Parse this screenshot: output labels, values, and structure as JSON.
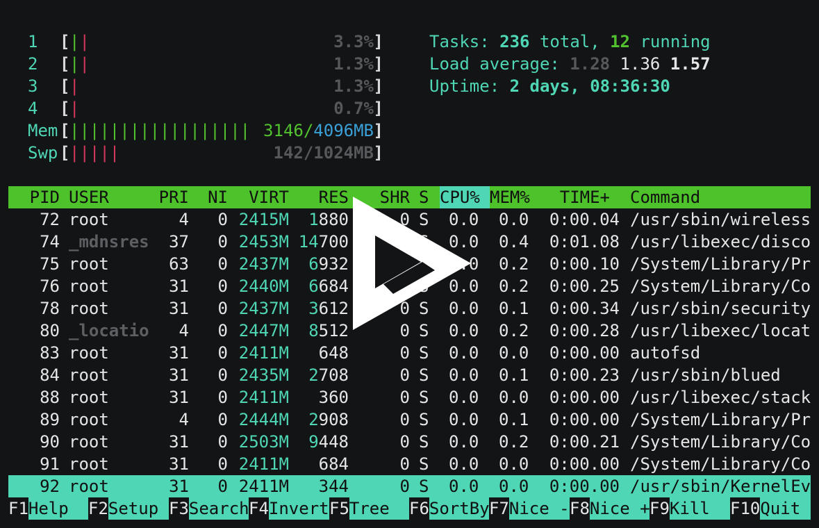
{
  "cpu_meters": [
    {
      "label": "1",
      "bars": [
        {
          "t": "|",
          "c": "green"
        },
        {
          "t": "|",
          "c": "red"
        }
      ],
      "value": "3.3%"
    },
    {
      "label": "2",
      "bars": [
        {
          "t": "|",
          "c": "green"
        },
        {
          "t": "|",
          "c": "red"
        }
      ],
      "value": "1.3%"
    },
    {
      "label": "3",
      "bars": [
        {
          "t": "|",
          "c": "red"
        }
      ],
      "value": "1.3%"
    },
    {
      "label": "4",
      "bars": [
        {
          "t": "|",
          "c": "red"
        }
      ],
      "value": "0.7%"
    }
  ],
  "mem": {
    "label": "Mem",
    "bars": "||||||||||||||||||",
    "used": "3146",
    "sep": "/",
    "total": "4096MB"
  },
  "swp": {
    "label": "Swp",
    "bars": "|||||",
    "value": "142/1024MB"
  },
  "tasks": {
    "prefix": "Tasks: ",
    "total": "236",
    "total_suffix": " total, ",
    "running": "12",
    "running_suffix": " running"
  },
  "load": {
    "prefix": "Load average: ",
    "l1": "1.28",
    "l5": "1.36",
    "l15": "1.57"
  },
  "uptime": {
    "prefix": "Uptime: ",
    "value": "2 days, 08:36:30"
  },
  "columns": {
    "pid": "PID",
    "user": "USER",
    "pri": "PRI",
    "ni": "NI",
    "virt": "VIRT",
    "res": "RES",
    "shr": "SHR",
    "s": "S",
    "cpu": "CPU%",
    "mem": "MEM%",
    "time": "TIME+",
    "command": "Command"
  },
  "processes": [
    {
      "pid": "72",
      "user": "root",
      "user_dim": false,
      "pri": "4",
      "ni": "0",
      "virt": "2415M",
      "res_hi": "1",
      "res_lo": "880",
      "shr": "0",
      "s": "S",
      "cpu": "0.0",
      "mem": "0.0",
      "time": "0:00.04",
      "command": "/usr/sbin/wireless"
    },
    {
      "pid": "74",
      "user": "_mdnsres",
      "user_dim": true,
      "pri": "37",
      "ni": "0",
      "virt": "2453M",
      "res_hi": "14",
      "res_lo": "700",
      "shr": "0",
      "s": "S",
      "cpu": "0.0",
      "mem": "0.4",
      "time": "0:01.08",
      "command": "/usr/libexec/disco"
    },
    {
      "pid": "75",
      "user": "root",
      "user_dim": false,
      "pri": "63",
      "ni": "0",
      "virt": "2437M",
      "res_hi": "6",
      "res_lo": "932",
      "shr": "0",
      "s": "S",
      "cpu": "0.0",
      "mem": "0.2",
      "time": "0:00.10",
      "command": "/System/Library/Pr"
    },
    {
      "pid": "76",
      "user": "root",
      "user_dim": false,
      "pri": "31",
      "ni": "0",
      "virt": "2440M",
      "res_hi": "6",
      "res_lo": "684",
      "shr": "0",
      "s": "S",
      "cpu": "0.0",
      "mem": "0.2",
      "time": "0:00.25",
      "command": "/System/Library/Co"
    },
    {
      "pid": "78",
      "user": "root",
      "user_dim": false,
      "pri": "31",
      "ni": "0",
      "virt": "2437M",
      "res_hi": "3",
      "res_lo": "612",
      "shr": "0",
      "s": "S",
      "cpu": "0.0",
      "mem": "0.1",
      "time": "0:00.34",
      "command": "/usr/sbin/security"
    },
    {
      "pid": "80",
      "user": "_locatio",
      "user_dim": true,
      "pri": "4",
      "ni": "0",
      "virt": "2447M",
      "res_hi": "8",
      "res_lo": "512",
      "shr": "0",
      "s": "S",
      "cpu": "0.0",
      "mem": "0.2",
      "time": "0:00.28",
      "command": "/usr/libexec/locat"
    },
    {
      "pid": "83",
      "user": "root",
      "user_dim": false,
      "pri": "31",
      "ni": "0",
      "virt": "2411M",
      "res_hi": "",
      "res_lo": "648",
      "shr": "0",
      "s": "S",
      "cpu": "0.0",
      "mem": "0.0",
      "time": "0:00.00",
      "command": "autofsd"
    },
    {
      "pid": "84",
      "user": "root",
      "user_dim": false,
      "pri": "31",
      "ni": "0",
      "virt": "2435M",
      "res_hi": "2",
      "res_lo": "708",
      "shr": "0",
      "s": "S",
      "cpu": "0.0",
      "mem": "0.1",
      "time": "0:00.23",
      "command": "/usr/sbin/blued"
    },
    {
      "pid": "88",
      "user": "root",
      "user_dim": false,
      "pri": "31",
      "ni": "0",
      "virt": "2411M",
      "res_hi": "",
      "res_lo": "360",
      "shr": "0",
      "s": "S",
      "cpu": "0.0",
      "mem": "0.0",
      "time": "0:00.00",
      "command": "/usr/libexec/stack"
    },
    {
      "pid": "89",
      "user": "root",
      "user_dim": false,
      "pri": "4",
      "ni": "0",
      "virt": "2444M",
      "res_hi": "2",
      "res_lo": "908",
      "shr": "0",
      "s": "S",
      "cpu": "0.0",
      "mem": "0.1",
      "time": "0:00.00",
      "command": "/System/Library/Pr"
    },
    {
      "pid": "90",
      "user": "root",
      "user_dim": false,
      "pri": "31",
      "ni": "0",
      "virt": "2503M",
      "res_hi": "9",
      "res_lo": "448",
      "shr": "0",
      "s": "S",
      "cpu": "0.0",
      "mem": "0.2",
      "time": "0:00.21",
      "command": "/System/Library/Co"
    },
    {
      "pid": "91",
      "user": "root",
      "user_dim": false,
      "pri": "31",
      "ni": "0",
      "virt": "2411M",
      "res_hi": "",
      "res_lo": "684",
      "shr": "0",
      "s": "S",
      "cpu": "0.0",
      "mem": "0.0",
      "time": "0:00.00",
      "command": "/System/Library/Co"
    },
    {
      "pid": "92",
      "user": "root",
      "user_dim": false,
      "pri": "31",
      "ni": "0",
      "virt": "2411M",
      "res_hi": "",
      "res_lo": "344",
      "shr": "0",
      "s": "S",
      "cpu": "0.0",
      "mem": "0.0",
      "time": "0:00.00",
      "command": "/usr/sbin/KernelEv",
      "selected": true
    }
  ],
  "footer": [
    {
      "key": "F1",
      "label": "Help  "
    },
    {
      "key": "F2",
      "label": "Setup "
    },
    {
      "key": "F3",
      "label": "Search"
    },
    {
      "key": "F4",
      "label": "Invert"
    },
    {
      "key": "F5",
      "label": "Tree  "
    },
    {
      "key": "F6",
      "label": "SortBy"
    },
    {
      "key": "F7",
      "label": "Nice -"
    },
    {
      "key": "F8",
      "label": "Nice +"
    },
    {
      "key": "F9",
      "label": "Kill  "
    },
    {
      "key": "F10",
      "label": "Quit  "
    }
  ],
  "overlay": {
    "icon": "play-logo-icon"
  },
  "colors": {
    "background": "#131416",
    "header_green": "#4ec22a",
    "teal": "#4fd6b4",
    "bar_green": "#52c22f",
    "bar_red": "#d6375c",
    "mem_blue": "#3aa0d8"
  }
}
